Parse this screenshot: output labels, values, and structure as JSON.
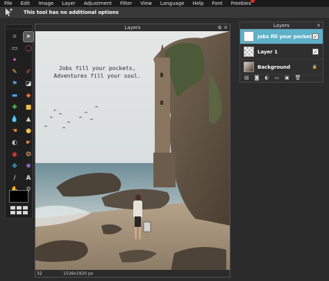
{
  "menu": {
    "items": [
      "File",
      "Edit",
      "Image",
      "Layer",
      "Adjustment",
      "Filter",
      "View",
      "Language",
      "Help",
      "Font",
      "Freebies"
    ]
  },
  "options_bar": {
    "text": "This tool has no additional options"
  },
  "document": {
    "title": "Layers",
    "quote_line1": "Jobs fill your pockets,",
    "quote_line2": "Adventures fill your soul.",
    "zoom": "32",
    "dimensions": "1536x1920 px"
  },
  "layers_panel": {
    "title": "Layers",
    "layers": [
      {
        "name": "Jobs fill your pockets,",
        "selected": true,
        "visible": true
      },
      {
        "name": "Layer 1",
        "selected": false,
        "visible": true
      },
      {
        "name": "Background",
        "selected": false,
        "locked": true
      }
    ]
  },
  "colors": {
    "accent": "#5fb0c9",
    "badge": "#e02b2b",
    "foreground": "#000000"
  }
}
